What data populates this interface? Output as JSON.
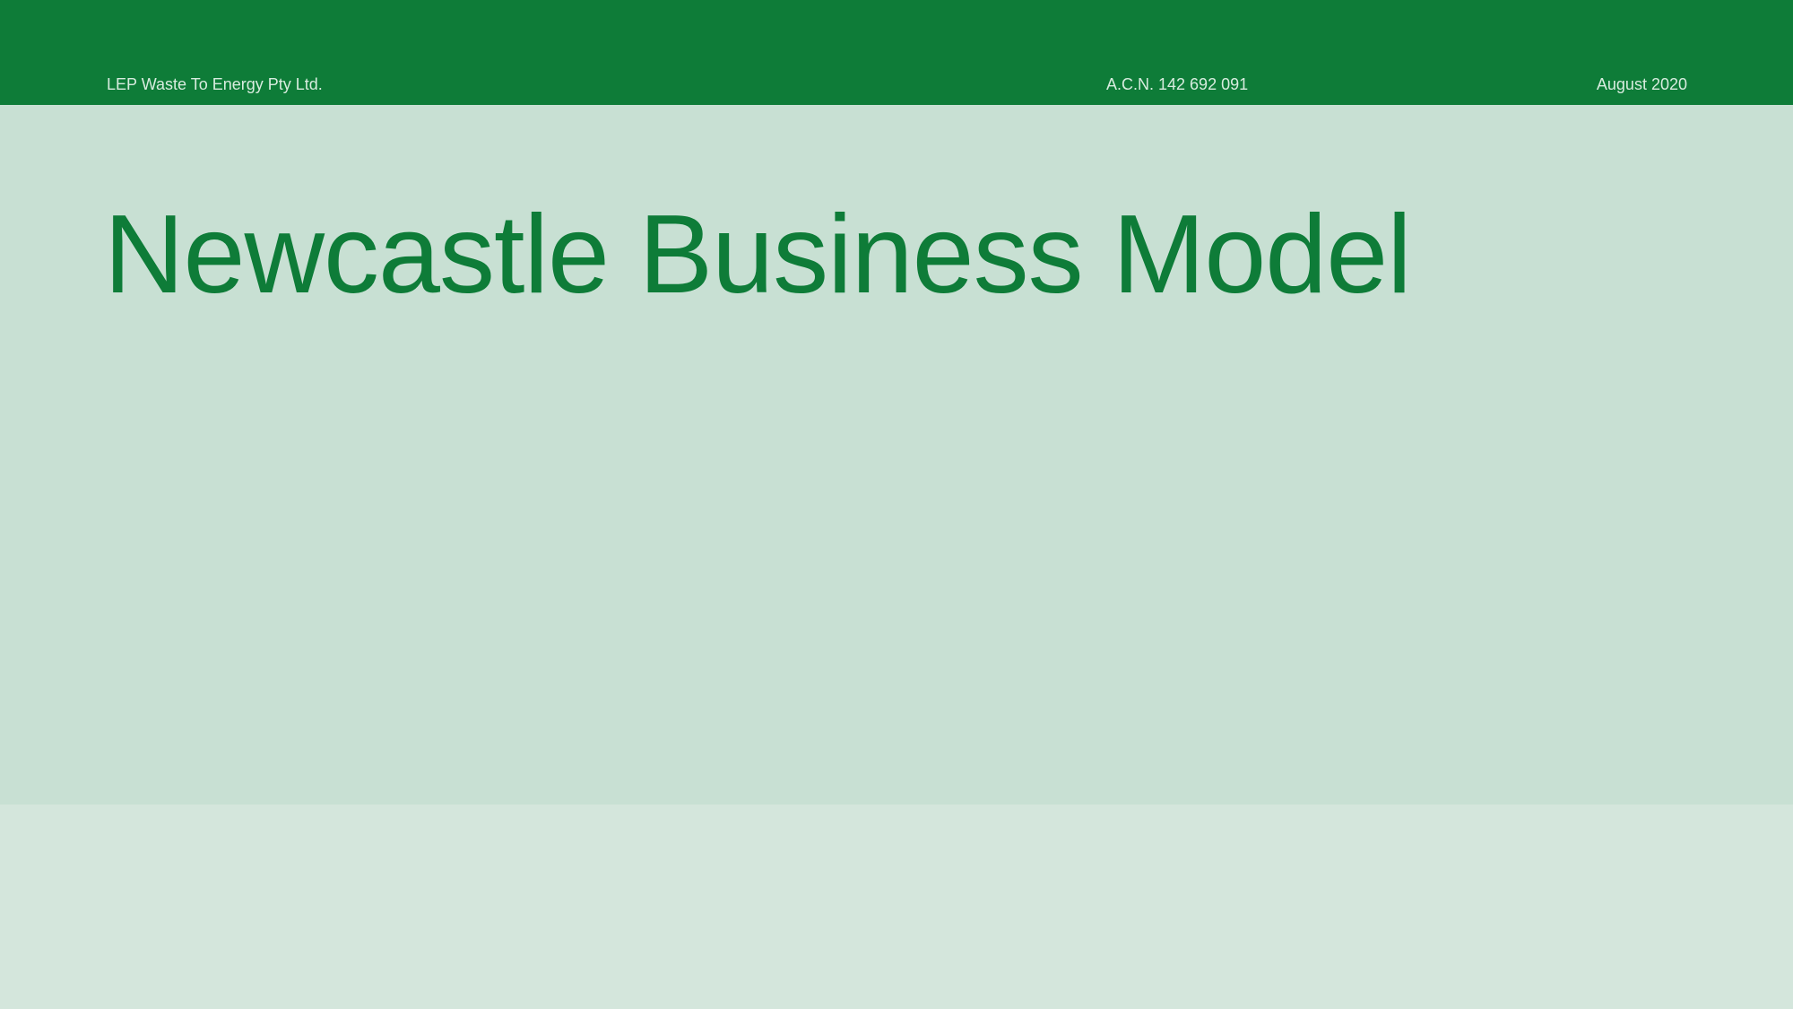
{
  "header": {
    "company": "LEP Waste To Energy Pty Ltd.",
    "acn": "A.C.N. 142 692 091",
    "date": "August 2020"
  },
  "slide": {
    "title": "Newcastle Business Model"
  },
  "colors": {
    "brand_green": "#0e7c38",
    "header_text": "#d8ecdf",
    "main_panel": "#c8e0d3",
    "lower_panel": "#d4e6dc"
  }
}
